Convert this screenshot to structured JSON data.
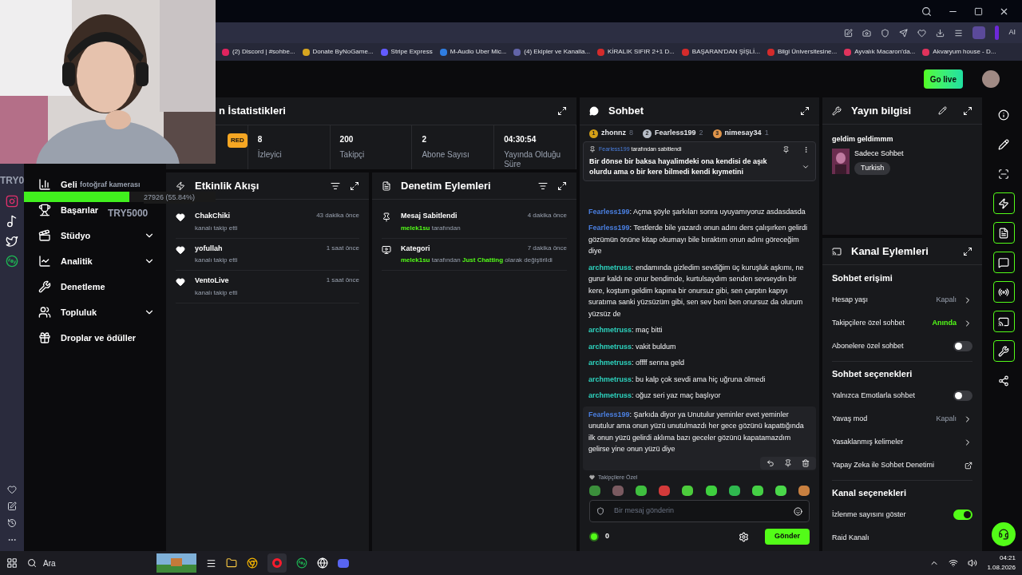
{
  "browser": {
    "toolbar_label": "AI",
    "bookmarks": [
      {
        "label": "(2) Discord | #sohbe...",
        "color": "#e0245e"
      },
      {
        "label": "Donate ByNoGame...",
        "color": "#d6a520"
      },
      {
        "label": "Stripe Express",
        "color": "#635bff"
      },
      {
        "label": "M-Audio Uber Mic...",
        "color": "#2f7de1"
      },
      {
        "label": "(4) Ekipler ve Kanalla...",
        "color": "#6264a7"
      },
      {
        "label": "KİRALIK SIFIR 2+1 D...",
        "color": "#d42b2b"
      },
      {
        "label": "BAŞARAN'DAN ŞİŞLİ...",
        "color": "#d42b2b"
      },
      {
        "label": "Bilgi Üniversitesine...",
        "color": "#d42b2b"
      },
      {
        "label": "Ayvalık Macaron'da...",
        "color": "#e0335c"
      },
      {
        "label": "Akvaryum house - D...",
        "color": "#e0335c"
      }
    ]
  },
  "header": {
    "go_live": "Go live"
  },
  "overlay": {
    "camera_label": "fotoğraf kamerası",
    "goal_text": "27926 (55.84%)",
    "goal": {
      "level": 0.55
    },
    "ticker_left": "TRY0",
    "ticker_right": "TRY5000"
  },
  "nav": [
    {
      "label": "Geli",
      "has_submenu": false
    },
    {
      "label": "Başarılar",
      "has_submenu": false
    },
    {
      "label": "Stüdyo",
      "has_submenu": true
    },
    {
      "label": "Analitik",
      "has_submenu": true
    },
    {
      "label": "Denetleme",
      "has_submenu": false
    },
    {
      "label": "Topluluk",
      "has_submenu": true
    },
    {
      "label": "Droplar ve ödüller",
      "has_submenu": false
    }
  ],
  "stats": {
    "title": "n İstatistikleri",
    "badge": "RED",
    "cells": [
      {
        "value": "8",
        "label": "İzleyici"
      },
      {
        "value": "200",
        "label": "Takipçi"
      },
      {
        "value": "2",
        "label": "Abone Sayısı"
      },
      {
        "value": "04:30:54",
        "label": "Yayında Olduğu Süre"
      }
    ]
  },
  "activity": {
    "title": "Etkinlik Akışı",
    "items": [
      {
        "name": "ChakChiki",
        "action": "kanalı takip etti",
        "time": "43 dakika önce"
      },
      {
        "name": "yofullah",
        "action": "kanalı takip etti",
        "time": "1 saat önce"
      },
      {
        "name": "VentoLive",
        "action": "kanalı takip etti",
        "time": "1 saat önce"
      }
    ]
  },
  "moderation": {
    "title": "Denetim Eylemleri",
    "items": [
      {
        "kind": "pin",
        "title": "Mesaj Sabitlendi",
        "time": "4 dakika önce",
        "detail": [
          {
            "text": "melek1su",
            "highlight": true
          },
          {
            "text": " tarafından",
            "highlight": false
          }
        ]
      },
      {
        "kind": "category",
        "title": "Kategori",
        "time": "7 dakika önce",
        "detail": [
          {
            "text": "melek1su",
            "highlight": true
          },
          {
            "text": " tarafından ",
            "highlight": false
          },
          {
            "text": "Just Chatting",
            "highlight": true
          },
          {
            "text": " olarak değiştirildi",
            "highlight": false
          }
        ]
      }
    ]
  },
  "chat": {
    "title": "Sohbet",
    "leaders": [
      {
        "rank": "1",
        "color": "#d4a017",
        "name": "zhonnz",
        "count": "8"
      },
      {
        "rank": "2",
        "color": "#b8bec8",
        "name": "Fearless199",
        "count": "2"
      },
      {
        "rank": "3",
        "color": "#e0954a",
        "name": "nimesay34",
        "count": "1"
      }
    ],
    "pinned": {
      "user": "Fearless199",
      "suffix": "tarafından sabitlendi",
      "text": "Bir dönse bir baksa hayalimdeki ona kendisi de aşık olurdu ama o bir kere bilmedi kendi kıymetini"
    },
    "messages": [
      {
        "user": "Fearless199",
        "color": "#4a7fe0",
        "text": ": Açma şöyle şarkıları sonra uyuyamıyoruz asdasdasda",
        "hovered": false
      },
      {
        "user": "Fearless199",
        "color": "#4a7fe0",
        "text": ": Testlerde bile yazardı onun adını ders çalışırken gelirdi gözümün önüne kitap okumayı bile bıraktım onun adını göreceğim diye",
        "hovered": false
      },
      {
        "user": "archmetruss",
        "color": "#2dd4bf",
        "text": ": endamında gizledim sevdiğim üç kuruşluk aşkımı, ne gurur kaldı ne onur bendimde, kurtulsaydım senden sevseydin bir kere, koştum geldim kapına bir onursuz gibi, sen çarptın kapıyı suratıma sanki yüzsüzüm gibi, sen sev beni ben onursuz da olurum yüzsüz de",
        "hovered": false
      },
      {
        "user": "archmetruss",
        "color": "#2dd4bf",
        "text": ": maç bitti",
        "hovered": false
      },
      {
        "user": "archmetruss",
        "color": "#2dd4bf",
        "text": ": vakit buldum",
        "hovered": false
      },
      {
        "user": "archmetruss",
        "color": "#2dd4bf",
        "text": ": offff senna geld",
        "hovered": false
      },
      {
        "user": "archmetruss",
        "color": "#2dd4bf",
        "text": ": bu kalp çok sevdi ama hiç uğruna ölmedi",
        "hovered": false
      },
      {
        "user": "archmetruss",
        "color": "#2dd4bf",
        "text": ": oğuz seri yaz maç başlıyor",
        "hovered": false
      },
      {
        "user": "Fearless199",
        "color": "#4a7fe0",
        "text": ": Şarkıda diyor ya Unutulur yeminler evet yeminler unutulur ama onun yüzü unutulmazdı her gece gözünü kapattığında ilk onun yüzü gelirdi aklıma bazı geceler gözünü kapatamazdım gelirse yine onun yüzü diye",
        "hovered": true
      }
    ],
    "emote_label": "Takipçilere Özel",
    "emotes": [
      {
        "color": "#3b8f3b"
      },
      {
        "color": "#7a5a60"
      },
      {
        "color": "#3fbf3f"
      },
      {
        "color": "#d33a3a"
      },
      {
        "color": "#4ccc3c"
      },
      {
        "color": "#3fd03f"
      },
      {
        "color": "#2fb84f"
      },
      {
        "color": "#45d045"
      },
      {
        "color": "#4ad84a"
      },
      {
        "color": "#c88040"
      }
    ],
    "input": {
      "placeholder": "Bir mesaj gönderin"
    },
    "points": "0",
    "send": "Gönder"
  },
  "stream_info": {
    "title": "Yayın bilgisi",
    "stream_title": "geldim geldimmm",
    "category": "Sadece Sohbet",
    "tag": "Turkish"
  },
  "channel_actions": {
    "title": "Kanal Eylemleri",
    "rows": [
      {
        "kind": "heading",
        "label": "Sohbet erişimi"
      },
      {
        "kind": "value",
        "label": "Hesap yaşı",
        "value": "Kapalı",
        "highlight": false
      },
      {
        "kind": "value",
        "label": "Takipçilere özel sohbet",
        "value": "Anında",
        "highlight": true
      },
      {
        "kind": "toggle",
        "label": "Abonelere özel sohbet",
        "on": false
      },
      {
        "kind": "heading",
        "label": "Sohbet seçenekleri"
      },
      {
        "kind": "toggle",
        "label": "Yalnızca Emotlarla sohbet",
        "on": false
      },
      {
        "kind": "value",
        "label": "Yavaş mod",
        "value": "Kapalı",
        "highlight": false
      },
      {
        "kind": "chevron",
        "label": "Yasaklanmış kelimeler"
      },
      {
        "kind": "link",
        "label": "Yapay Zeka ile Sohbet Denetimi"
      },
      {
        "kind": "heading",
        "label": "Kanal seçenekleri"
      },
      {
        "kind": "toggle",
        "label": "İzlenme sayısını göster",
        "on": true
      },
      {
        "kind": "plain",
        "label": "Raid Kanalı"
      }
    ]
  },
  "rail": [
    {
      "kind": "info",
      "on": false
    },
    {
      "kind": "edit",
      "on": false
    },
    {
      "kind": "screen",
      "on": false
    },
    {
      "kind": "bolt",
      "on": true
    },
    {
      "kind": "notes",
      "on": true
    },
    {
      "kind": "chat",
      "on": true
    },
    {
      "kind": "broadcast",
      "on": true
    },
    {
      "kind": "channel",
      "on": true
    },
    {
      "kind": "wrench",
      "on": true
    },
    {
      "kind": "dots",
      "on": false
    }
  ],
  "taskbar": {
    "search": "Ara",
    "time": "04:21",
    "date": "1.08.2026"
  }
}
